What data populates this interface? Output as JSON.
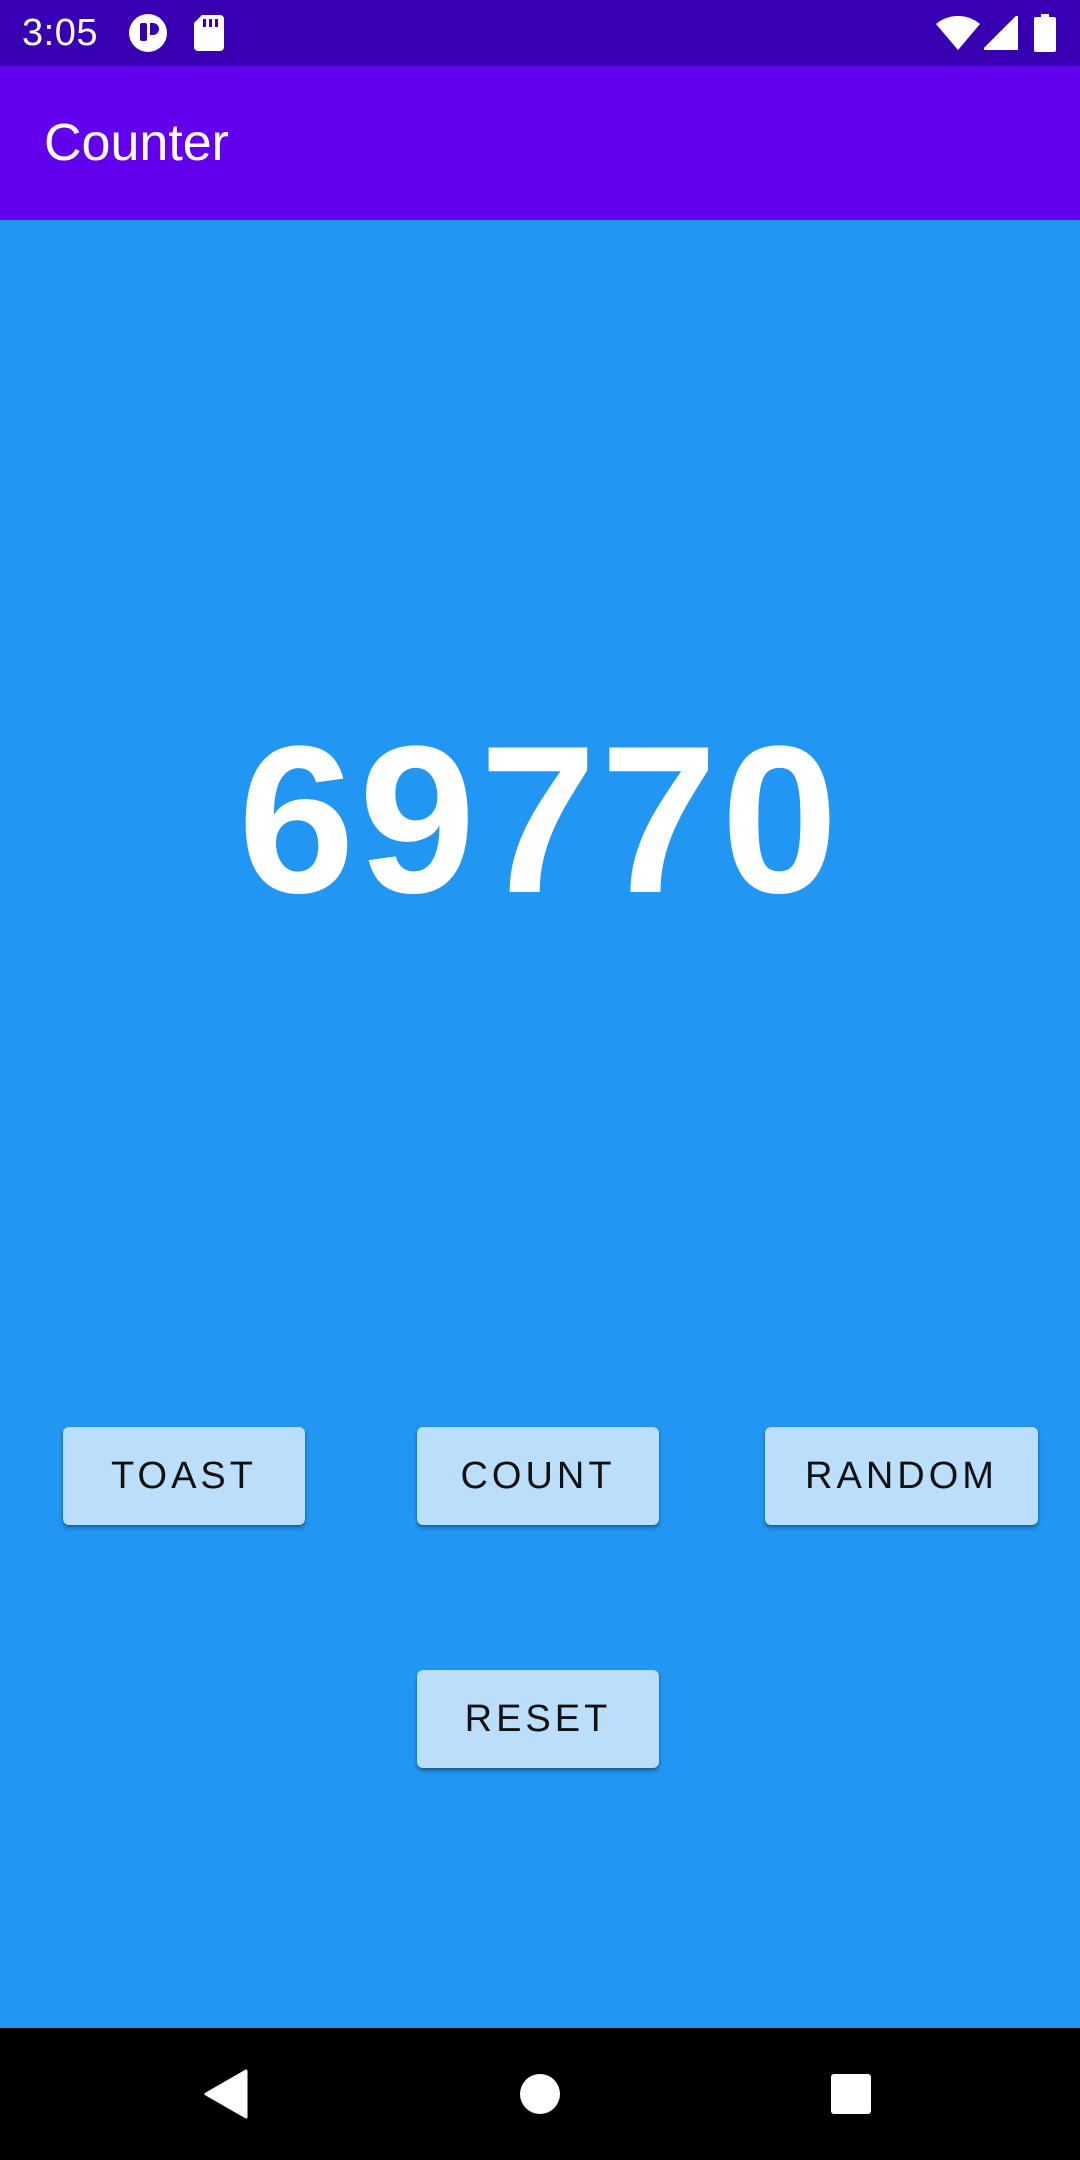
{
  "status_bar": {
    "time": "3:05",
    "icons": [
      "shield-notification-icon",
      "sd-card-icon",
      "wifi-icon",
      "cell-signal-icon",
      "battery-icon"
    ],
    "color": "#3700B3"
  },
  "app_bar": {
    "title": "Counter",
    "color": "#6200EE"
  },
  "main": {
    "count_value": "69770",
    "background_color": "#2196F3"
  },
  "buttons": {
    "toast": "TOAST",
    "count": "COUNT",
    "random": "RANDOM",
    "reset": "RESET",
    "color": "#BBDEFB"
  },
  "nav_bar": {
    "icons": [
      "back-icon",
      "home-icon",
      "recents-icon"
    ]
  }
}
